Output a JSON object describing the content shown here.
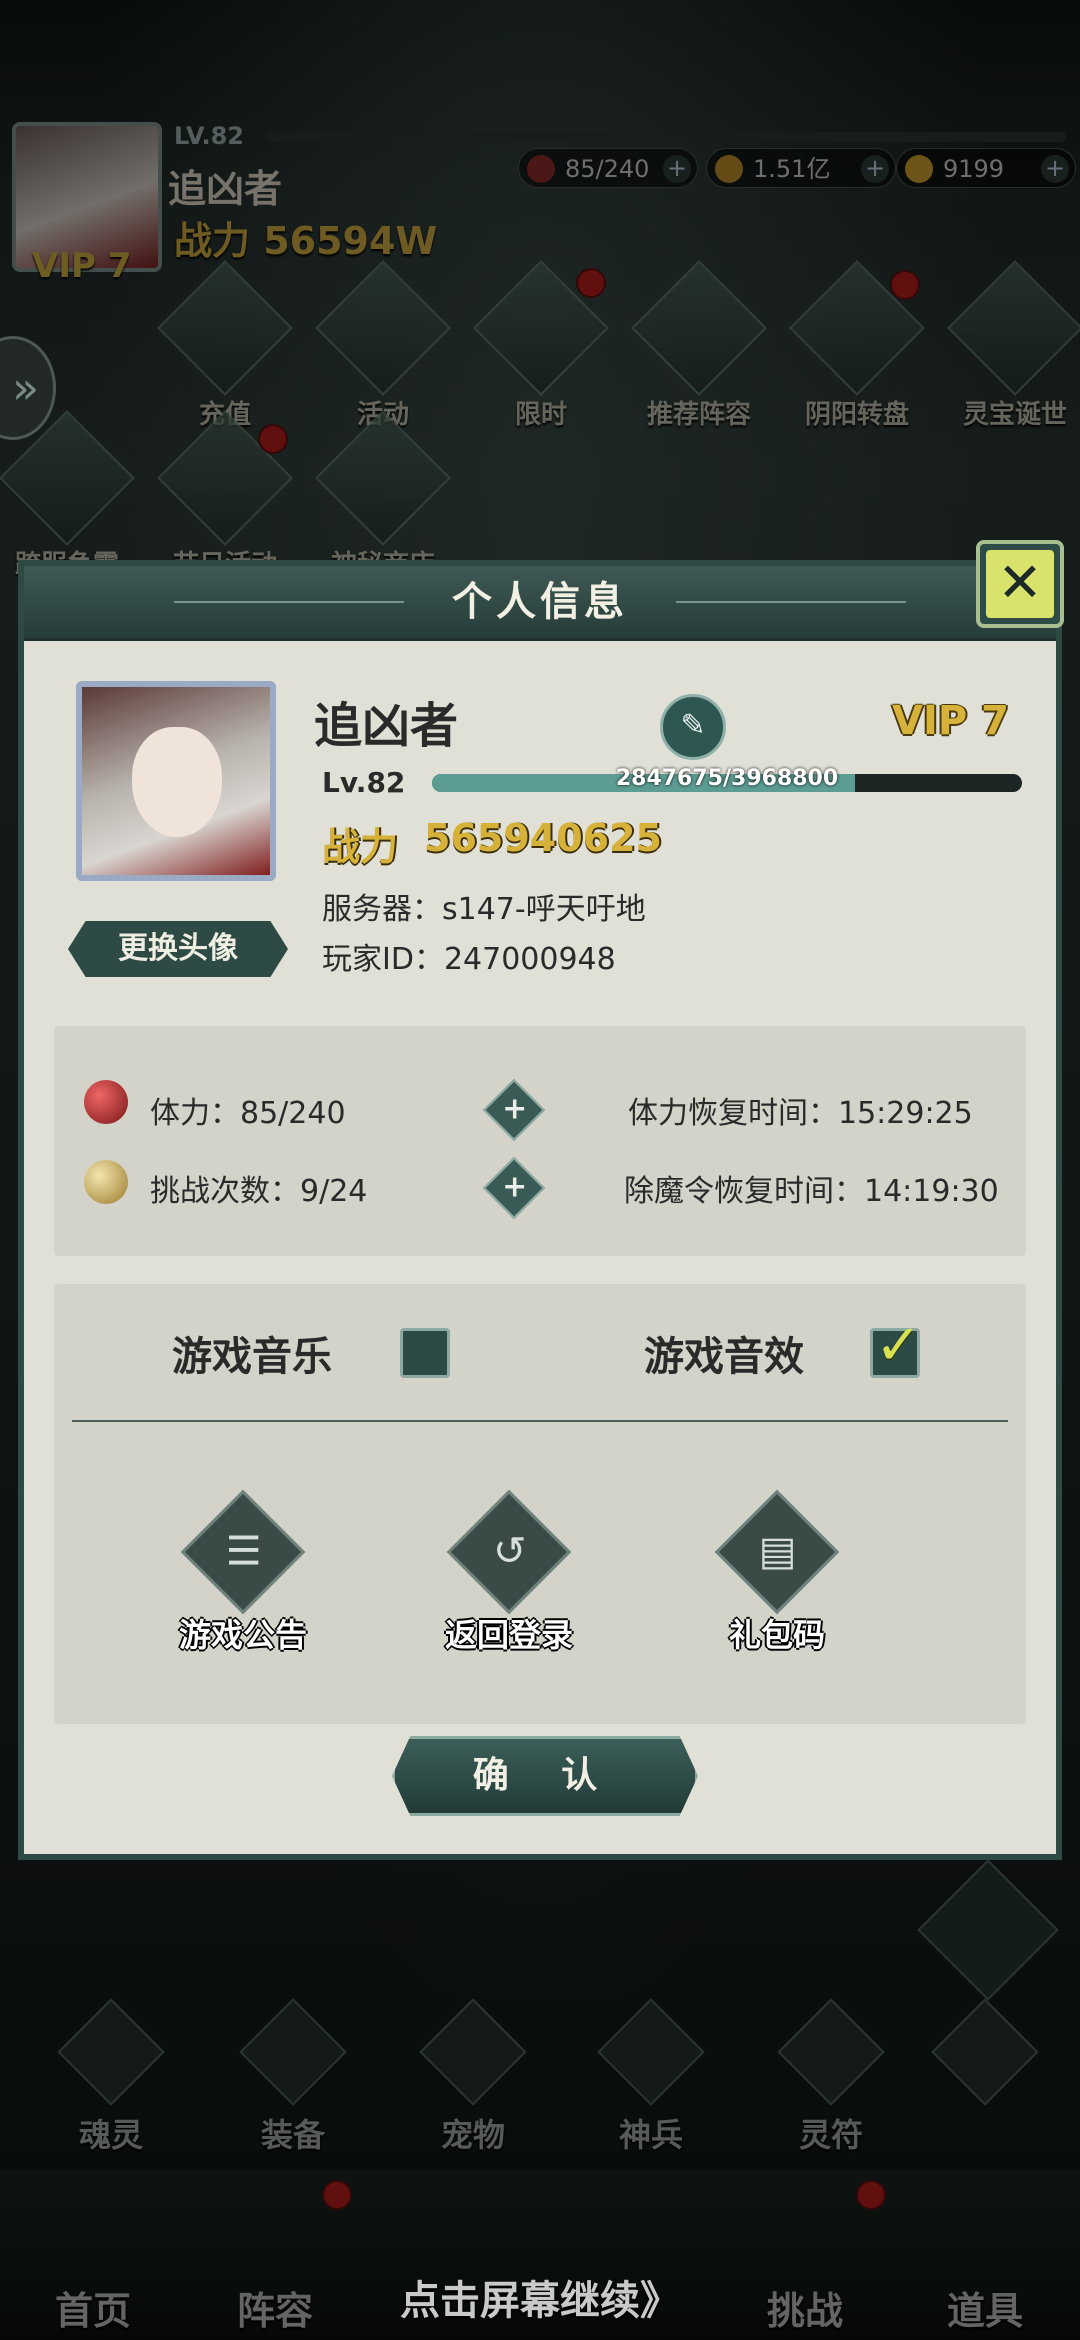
{
  "player_bar": {
    "level": "LV.82",
    "name": "追凶者",
    "power": "战力 56594W",
    "vip": "VIP 7"
  },
  "resources": [
    {
      "icon": "stamina-orb-icon",
      "value": "85/240"
    },
    {
      "icon": "coin-icon",
      "value": "1.51亿"
    },
    {
      "icon": "ingot-icon",
      "value": "9199"
    }
  ],
  "top_menu": [
    {
      "label": "充值",
      "icon": "gold-ingot-icon",
      "badge": false
    },
    {
      "label": "活动",
      "icon": "treasure-icon",
      "badge": false
    },
    {
      "label": "限时",
      "icon": "limited-offer-icon",
      "badge": true
    },
    {
      "label": "推荐阵容",
      "icon": "lineup-icon",
      "badge": false
    },
    {
      "label": "阴阳转盘",
      "icon": "roulette-icon",
      "badge": true
    },
    {
      "label": "灵宝诞世",
      "icon": "spirit-treasure-icon",
      "badge": false
    },
    {
      "label": "跨服争霸",
      "icon": "crossserver-icon",
      "badge": false
    },
    {
      "label": "节日活动",
      "icon": "festival-icon",
      "badge": true
    },
    {
      "label": "神秘商店",
      "icon": "shop-icon",
      "badge": false
    }
  ],
  "dialog": {
    "title": "个人信息",
    "name": "追凶者",
    "vip": "VIP 7",
    "level": "Lv.82",
    "exp_text": "2847675/3968800",
    "exp_progress": 0.7175,
    "power_label": "战力",
    "power_value": "565940625",
    "server": "服务器：s147-呼天吁地",
    "player_id": "玩家ID：247000948",
    "change_avatar": "更换头像",
    "stamina": "体力：85/240",
    "challenges": "挑战次数：9/24",
    "stamina_recover": "体力恢复时间：15:29:25",
    "demon_recover": "除魔令恢复时间：14:19:30",
    "music_label": "游戏音乐",
    "music_on": false,
    "sfx_label": "游戏音效",
    "sfx_on": true,
    "actions": [
      {
        "label": "游戏公告",
        "icon": "notice-icon"
      },
      {
        "label": "返回登录",
        "icon": "return-icon"
      },
      {
        "label": "礼包码",
        "icon": "giftcode-icon"
      }
    ],
    "confirm": "确  认"
  },
  "tools": [
    {
      "label": "魂灵",
      "icon": "soul-icon"
    },
    {
      "label": "装备",
      "icon": "equipment-icon"
    },
    {
      "label": "宠物",
      "icon": "pet-icon"
    },
    {
      "label": "神兵",
      "icon": "weapon-icon"
    },
    {
      "label": "灵符",
      "icon": "talisman-icon"
    },
    {
      "label": "",
      "icon": "plus-icon"
    }
  ],
  "nav": [
    {
      "label": "首页"
    },
    {
      "label": "阵容"
    },
    {
      "label": "挑战"
    },
    {
      "label": "道具"
    }
  ],
  "continue_hint": "点击屏幕继续》"
}
